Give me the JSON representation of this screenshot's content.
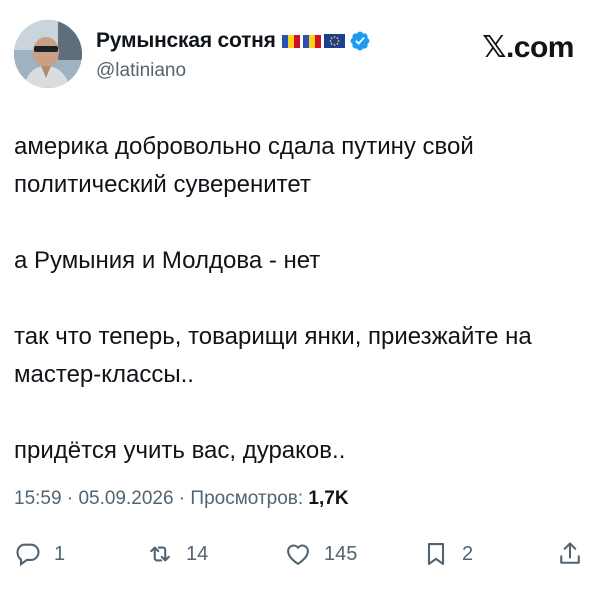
{
  "author": {
    "display_name": "Румынская сотня",
    "handle": "@latiniano"
  },
  "brand": "𝕏.com",
  "tweet": {
    "paragraphs": [
      "америка добровольно сдала путину свой политический суверенитет",
      "а Румыния и Молдова - нет",
      "так что теперь, товарищи янки, приезжайте на мастер-классы..",
      "придётся учить вас, дураков.."
    ]
  },
  "meta": {
    "time": "15:59",
    "separator": " · ",
    "date": "05.09.2026",
    "views_label": "Просмотров:",
    "views_count": "1,7K"
  },
  "actions": {
    "replies": "1",
    "reposts": "14",
    "likes": "145",
    "bookmarks": "2"
  },
  "colors": {
    "verified": "#1d9bf0",
    "secondary_text": "#536471",
    "primary_text": "#0f1419"
  },
  "icons": [
    "verified-badge-icon",
    "reply-icon",
    "repost-icon",
    "like-icon",
    "bookmark-icon",
    "share-icon"
  ]
}
